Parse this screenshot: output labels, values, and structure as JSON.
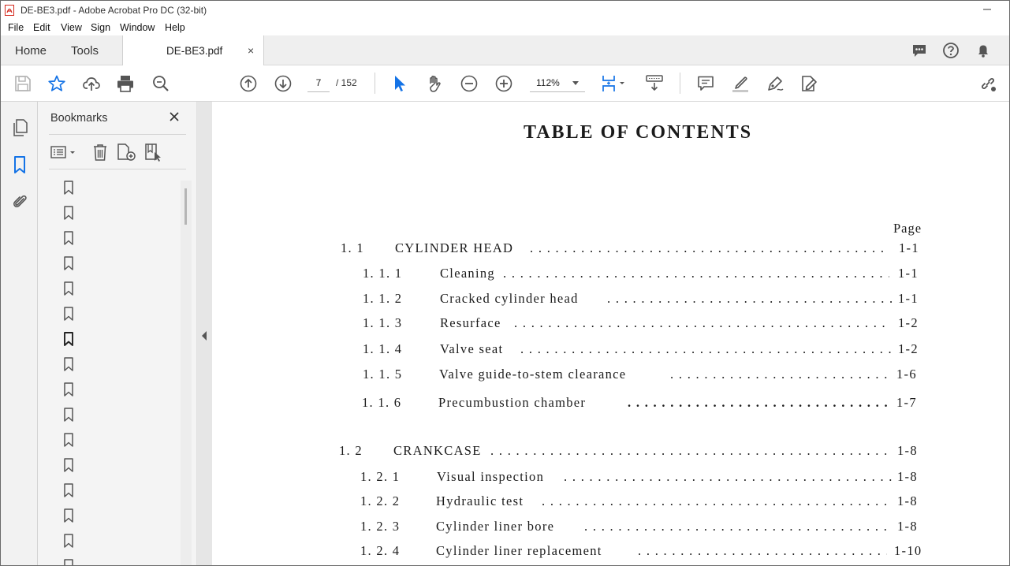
{
  "window": {
    "title": "DE-BE3.pdf - Adobe Acrobat Pro DC (32-bit)"
  },
  "menu": {
    "items": [
      "File",
      "Edit",
      "View",
      "Sign",
      "Window",
      "Help"
    ]
  },
  "tabs": {
    "home": "Home",
    "tools": "Tools",
    "document": "DE-BE3.pdf",
    "close_glyph": "×"
  },
  "toolbar": {
    "current_page": "7",
    "page_separator": "/ 152",
    "zoom": "112%"
  },
  "bookmarks": {
    "title": "Bookmarks",
    "count_visible": 16
  },
  "document": {
    "heading": "TABLE OF CONTENTS",
    "page_column_label": "Page",
    "entries": [
      {
        "num": "1. 1",
        "text": "CYLINDER HEAD",
        "page": "1-1",
        "level": 1
      },
      {
        "num": "1. 1. 1",
        "text": "Cleaning",
        "page": "1-1",
        "level": 2
      },
      {
        "num": "1. 1. 2",
        "text": "Cracked cylinder head",
        "page": "1-1",
        "level": 2
      },
      {
        "num": "1. 1. 3",
        "text": "Resurface",
        "page": "1-2",
        "level": 2
      },
      {
        "num": "1. 1. 4",
        "text": "Valve seat",
        "page": "1-2",
        "level": 2
      },
      {
        "num": "1. 1. 5",
        "text": "Valve guide-to-stem clearance",
        "page": "1-6",
        "level": 2
      },
      {
        "num": "1. 1. 6",
        "text": "Precumbustion chamber",
        "page": "1-7",
        "level": 2
      },
      {
        "num": "1. 2",
        "text": "CRANKCASE",
        "page": "1-8",
        "level": 1
      },
      {
        "num": "1. 2. 1",
        "text": "Visual inspection",
        "page": "1-8",
        "level": 2
      },
      {
        "num": "1. 2. 2",
        "text": "Hydraulic test",
        "page": "1-8",
        "level": 2
      },
      {
        "num": "1. 2. 3",
        "text": "Cylinder liner bore",
        "page": "1-8",
        "level": 2
      },
      {
        "num": "1. 2. 4",
        "text": "Cylinder liner replacement",
        "page": "1-10",
        "level": 2
      }
    ]
  },
  "colors": {
    "accent_blue": "#1473e6",
    "icon_gray": "#555555",
    "pdf_red": "#d4281c"
  }
}
